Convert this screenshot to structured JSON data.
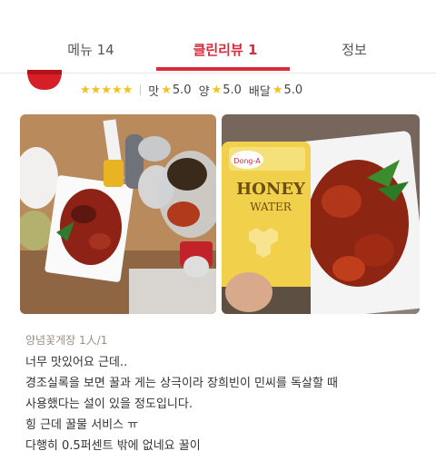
{
  "tabs": [
    {
      "label": "메뉴 14"
    },
    {
      "label": "클린리뷰 1"
    },
    {
      "label": "정보"
    }
  ],
  "rating": {
    "stars": "★★★★★",
    "taste_label": "맛",
    "taste_value": "5.0",
    "amount_label": "양",
    "amount_value": "5.0",
    "delivery_label": "배달",
    "delivery_value": "5.0"
  },
  "order": {
    "menu": "양념꽃게장 1人/1"
  },
  "review": {
    "lines": [
      "너무 맛있어요 근데..",
      "경조실록을 보면 꿀과 게는 상극이라 장희빈이 민씨를 독살할 때",
      "사용했다는 설이 있을 정도입니다.",
      "힝 근데 꿀물 서비스 ㅠ",
      "다행히 0.5퍼센트 밖에 없네요 꿀이"
    ]
  },
  "photo_right": {
    "can_brand": "Dong-A",
    "can_text_1": "HONEY",
    "can_text_2": "WATER"
  },
  "colors": {
    "accent": "#d92b3a",
    "star": "#f2c21b"
  }
}
